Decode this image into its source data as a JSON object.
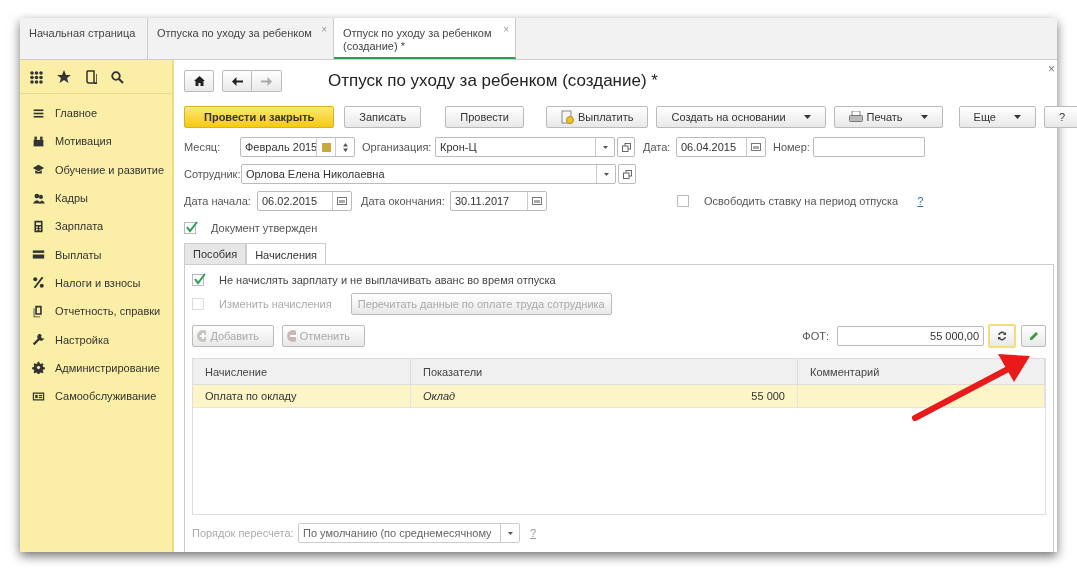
{
  "tabs": [
    {
      "label": "Начальная страница",
      "selected": false
    },
    {
      "label": "Отпуска по уходу за ребенком",
      "selected": false,
      "close": "×"
    },
    {
      "label": "Отпуск по уходу за ребенком (создание) *",
      "selected": true,
      "close": "×"
    }
  ],
  "form_close": "×",
  "sidebar": {
    "items": [
      {
        "label": "Главное"
      },
      {
        "label": "Мотивация"
      },
      {
        "label": "Обучение и развитие"
      },
      {
        "label": "Кадры"
      },
      {
        "label": "Зарплата"
      },
      {
        "label": "Выплаты"
      },
      {
        "label": "Налоги и взносы"
      },
      {
        "label": "Отчетность, справки"
      },
      {
        "label": "Настройка"
      },
      {
        "label": "Администрирование"
      },
      {
        "label": "Самообслуживание"
      }
    ]
  },
  "title": "Отпуск по уходу за ребенком (создание) *",
  "commands": [
    {
      "label": "Провести и закрыть",
      "kind": "primary"
    },
    {
      "label": "Записать",
      "kind": "plain"
    },
    {
      "label": "Провести",
      "kind": "plain"
    },
    {
      "label": "Выплатить",
      "kind": "pay"
    },
    {
      "label": "Создать на основании",
      "kind": "dropdown"
    },
    {
      "label": "Печать",
      "kind": "print"
    }
  ],
  "commands_right": [
    {
      "label": "Еще",
      "kind": "dropdown"
    },
    {
      "label": "?",
      "kind": "plain"
    }
  ],
  "month": {
    "label": "Месяц:",
    "value": "Февраль 2015"
  },
  "organization": {
    "label": "Организация:",
    "value": "Крон-Ц"
  },
  "date": {
    "label": "Дата:",
    "value": "06.04.2015"
  },
  "number": {
    "label": "Номер:"
  },
  "employee": {
    "label": "Сотрудник:",
    "value": "Орлова Елена Николаевна"
  },
  "start_date": {
    "label": "Дата начала:",
    "value": "06.02.2015"
  },
  "end_date": {
    "label": "Дата окончания:",
    "value": "30.11.2017"
  },
  "free_rate": {
    "label": "Освободить ставку на период отпуска",
    "checked": false,
    "help": "?"
  },
  "approved": {
    "label": "Документ утвержден",
    "checked": true
  },
  "inner_tabs": [
    {
      "label": "Пособия",
      "selected": false
    },
    {
      "label": "Начисления",
      "selected": true
    }
  ],
  "no_salary": {
    "label": "Не начислять зарплату и не выплачивать аванс во время отпуска",
    "checked": true,
    "disabled": false
  },
  "change_accruals": {
    "label": "Изменить начисления",
    "checked": false,
    "disabled": true
  },
  "reread_button": {
    "label": "Перечитать данные по оплате труда сотрудника",
    "disabled": true
  },
  "row_buttons": [
    {
      "label": "Добавить",
      "kind": "add",
      "disabled": true
    },
    {
      "label": "Отменить",
      "kind": "cancel",
      "disabled": true
    }
  ],
  "fot": {
    "label": "ФОТ:",
    "value": "55 000,00"
  },
  "table": {
    "columns": [
      "Начисление",
      "Показатели",
      "Комментарий"
    ],
    "rows": [
      {
        "accrual": "Оплата по окладу",
        "indicator": "Оклад",
        "amount": "55 000",
        "selected": true
      }
    ]
  },
  "recalc": {
    "label": "Порядок пересчета:",
    "value": "По умолчанию (по среднемесячному",
    "disabled": true,
    "help": "?"
  }
}
